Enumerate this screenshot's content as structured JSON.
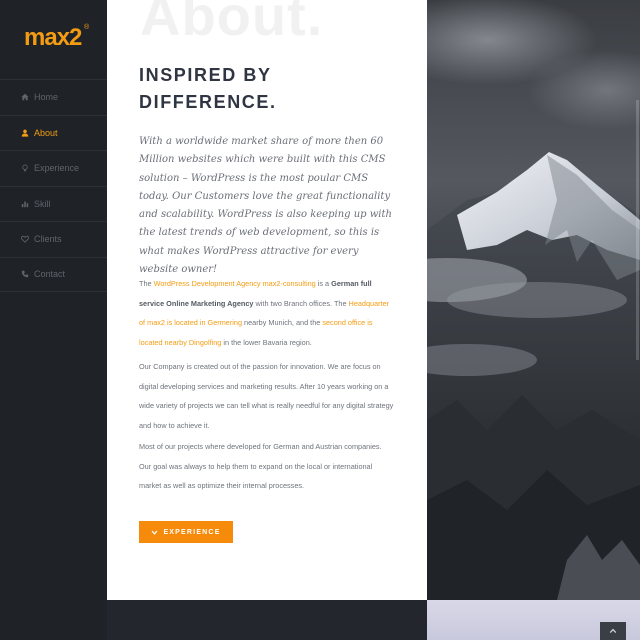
{
  "brand": {
    "logo_text": "max2",
    "logo_sup": "®",
    "accent": "#f39c12"
  },
  "sidebar": {
    "items": [
      {
        "label": "Home",
        "icon": "home-icon",
        "active": false
      },
      {
        "label": "About",
        "icon": "user-icon",
        "active": true
      },
      {
        "label": "Experience",
        "icon": "lightbulb-icon",
        "active": false
      },
      {
        "label": "Skill",
        "icon": "bar-chart-icon",
        "active": false
      },
      {
        "label": "Clients",
        "icon": "heart-icon",
        "active": false
      },
      {
        "label": "Contact",
        "icon": "phone-icon",
        "active": false
      }
    ]
  },
  "main": {
    "bg_word": "About.",
    "heading_line1": "INSPIRED BY",
    "heading_line2": "DIFFERENCE.",
    "lead": "With a worldwide market share of more then 60 Million websites which were built with this CMS solution – WordPress is the most poular CMS today. Our Customers love the great functionality and scalability. WordPress is also keeping up with the latest trends of web development, so this is what makes WordPress attractive for every website owner!",
    "p1": {
      "t1": "The ",
      "link1": "WordPress Development Agency max2-consulting",
      "t2": " is a ",
      "bold1": "German full service Online Marketing Agency",
      "t3": " with two Branch offices. The ",
      "link2": "Headquarter of max2 is located in Germering",
      "t4": " nearby Munich, and the ",
      "link3": "second office is located nearby Dingolfing",
      "t5": " in the lower Bavaria region."
    },
    "p2": "Our Company is created out of the passion for innovation. We are focus on digital developing services and marketing results. After 10 years working on a wide variety of projects we can tell what is really needful for any digital strategy and how to achieve it.",
    "p3": "Most of our projects where developed for German and Austrian companies. Our goal was always to help them to expand on the local or international market as well as optimize their internal processes.",
    "button_label": "EXPERIENCE"
  },
  "photo": {
    "subject": "snow-capped mountain in clouds"
  },
  "colors": {
    "sidebar_bg": "#1f2328",
    "button_bg": "#f68a0a",
    "heading": "#2f3542"
  }
}
